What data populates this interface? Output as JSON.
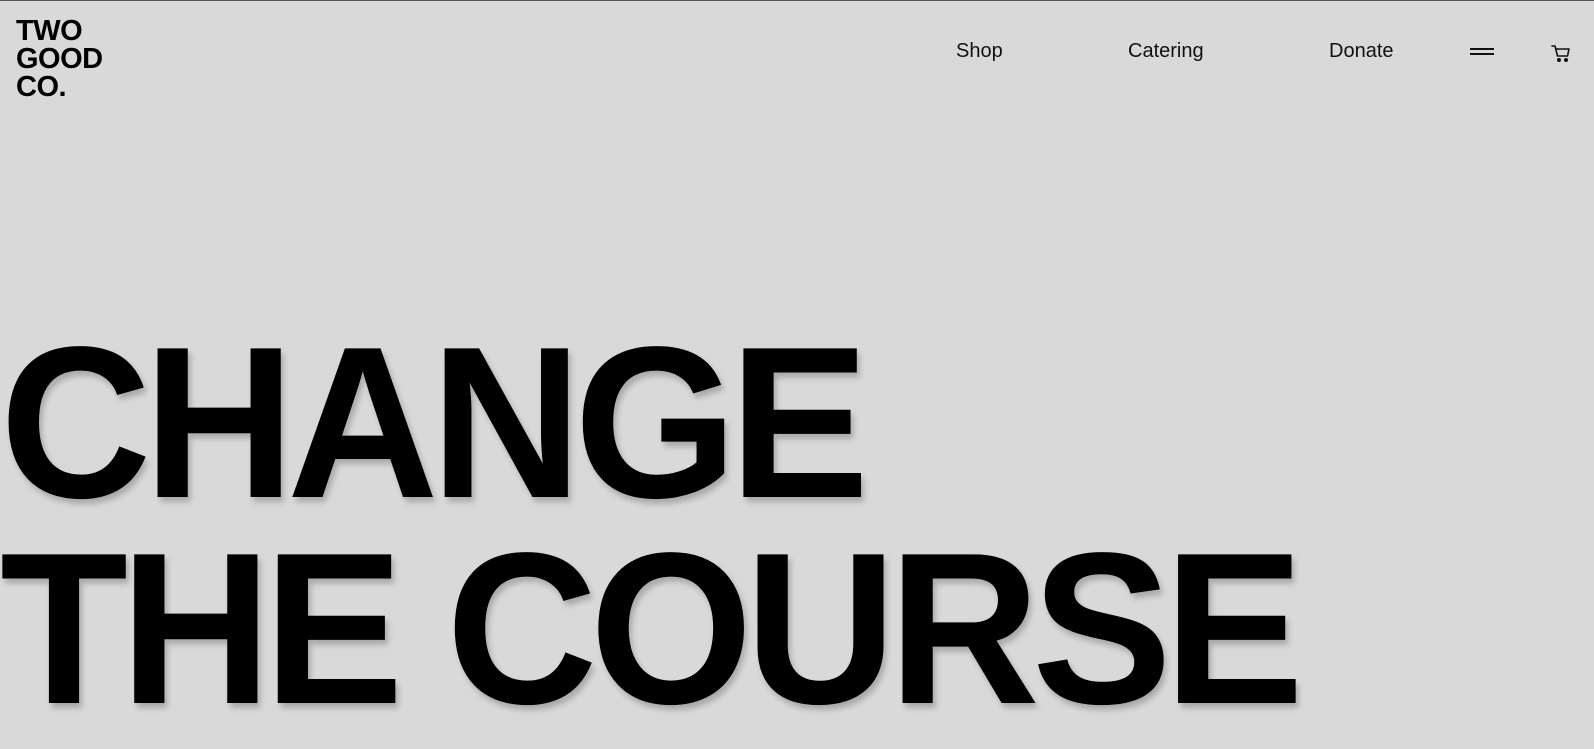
{
  "brand": {
    "logo_line1": "TWO",
    "logo_line2": "GOOD",
    "logo_line3": "CO."
  },
  "nav": {
    "links": [
      {
        "label": "Shop"
      },
      {
        "label": "Catering"
      },
      {
        "label": "Donate"
      }
    ],
    "menu_icon": "hamburger-icon",
    "cart_icon": "cart-icon"
  },
  "hero": {
    "line1": "CHANGE",
    "line2": "THE COURSE"
  },
  "colors": {
    "background": "#d9d9d9",
    "text": "#000000"
  }
}
